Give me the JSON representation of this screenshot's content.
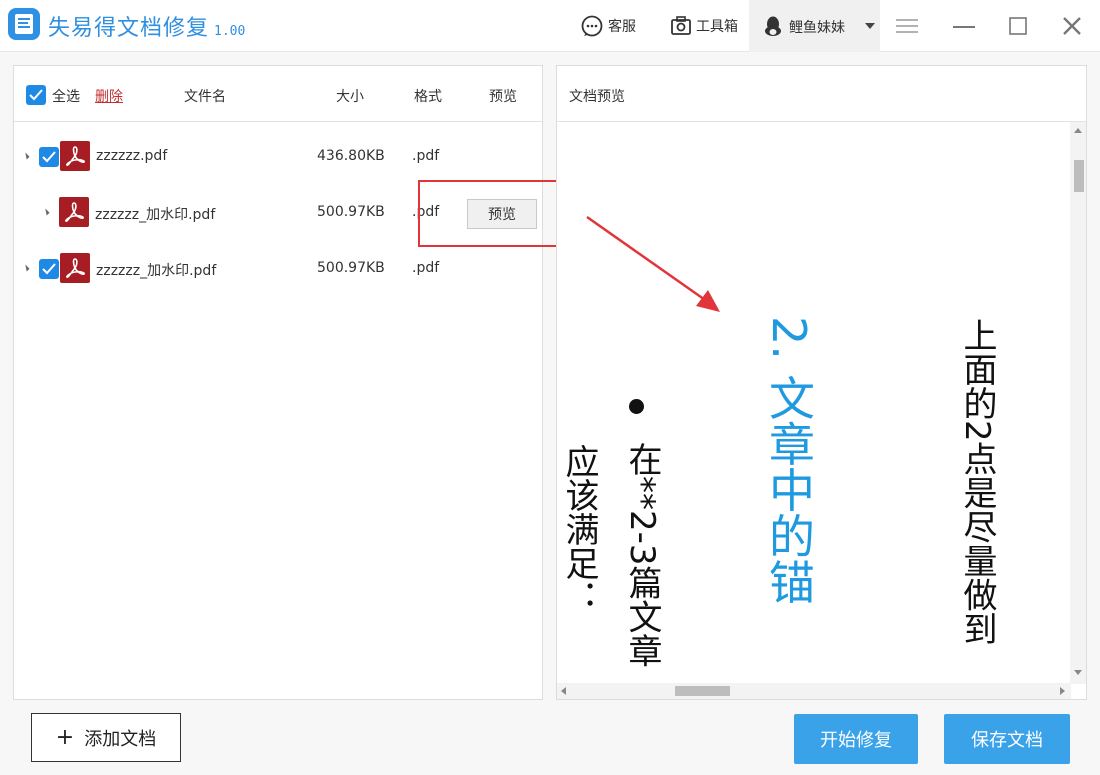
{
  "app": {
    "title": "失易得文档修复",
    "version": "1.00"
  },
  "titlebar": {
    "service_label": "客服",
    "toolbox_label": "工具箱",
    "username": "鲤鱼妹妹"
  },
  "list": {
    "select_all_label": "全选",
    "delete_label": "删除",
    "columns": {
      "name": "文件名",
      "size": "大小",
      "format": "格式",
      "preview": "预览"
    },
    "rows": [
      {
        "name": "zzzzzz.pdf",
        "size": "436.80KB",
        "format": ".pdf",
        "checked": true,
        "level": 0
      },
      {
        "name": "zzzzzz_加水印.pdf",
        "size": "500.97KB",
        "format": ".pdf",
        "checked": false,
        "level": 1,
        "preview_label": "预览"
      },
      {
        "name": "zzzzzz_加水印.pdf",
        "size": "500.97KB",
        "format": ".pdf",
        "checked": true,
        "level": 0
      }
    ]
  },
  "preview": {
    "title": "文档预览",
    "document_lines": [
      "上面的2点是尽量做到",
      "2. 文章中的锚",
      "在**2-3篇文章",
      "应该满足："
    ]
  },
  "bottom": {
    "add_label": "添加文档",
    "repair_label": "开始修复",
    "save_label": "保存文档"
  },
  "colors": {
    "accent": "#2f8fe0",
    "button_blue": "#3aa2e8",
    "delete_red": "#c23030",
    "pdf_red": "#a61d24",
    "highlight_red": "#e0353b",
    "heading_blue": "#1f9ae0"
  }
}
